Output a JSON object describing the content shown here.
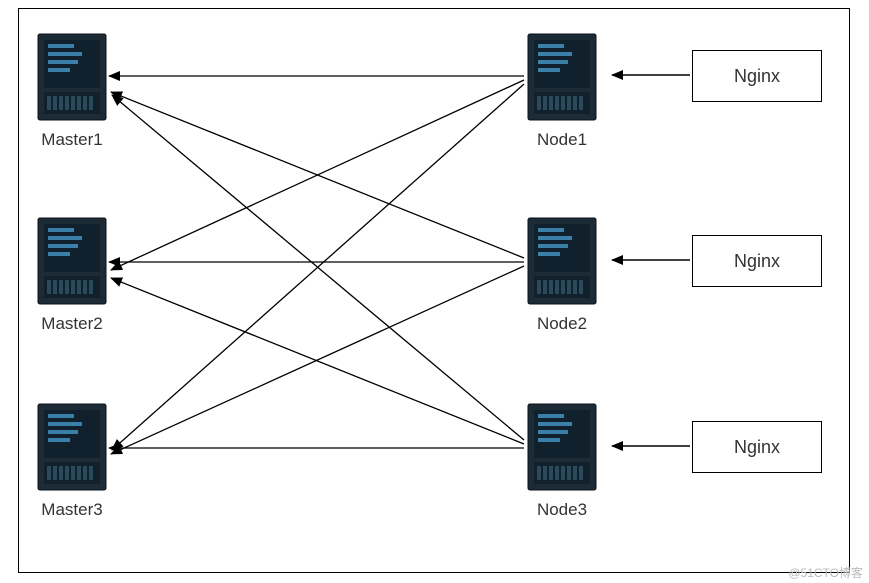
{
  "diagram": {
    "masters": [
      {
        "label": "Master1"
      },
      {
        "label": "Master2"
      },
      {
        "label": "Master3"
      }
    ],
    "nodes": [
      {
        "label": "Node1"
      },
      {
        "label": "Node2"
      },
      {
        "label": "Node3"
      }
    ],
    "nginx_boxes": [
      {
        "label": "Nginx"
      },
      {
        "label": "Nginx"
      },
      {
        "label": "Nginx"
      }
    ],
    "connections": {
      "node_to_masters": "each Node connects to all three Masters (full mesh, arrows point to Masters)",
      "nginx_to_node": "each Nginx box connects to its adjacent Node (arrow points to Node)"
    }
  },
  "watermark": "@51CTO博客"
}
